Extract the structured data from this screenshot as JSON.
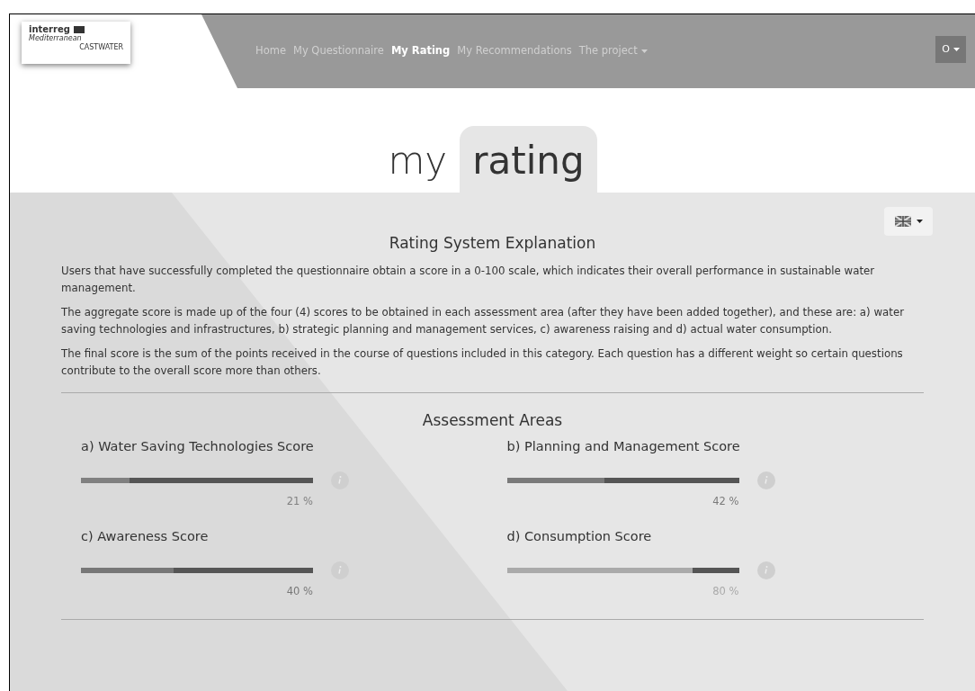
{
  "logo": {
    "line_1": "interreg",
    "line_2": "Mediterranean",
    "line_3": "CASTWATER"
  },
  "nav": {
    "items": [
      {
        "label": "Home",
        "selected": false,
        "dropdown": false
      },
      {
        "label": "My Questionnaire",
        "selected": false,
        "dropdown": false
      },
      {
        "label": "My Rating",
        "selected": true,
        "dropdown": false
      },
      {
        "label": "My Recommendations",
        "selected": false,
        "dropdown": false
      },
      {
        "label": "The project",
        "selected": false,
        "dropdown": true
      }
    ],
    "user_button": "O"
  },
  "title": {
    "word_1": "my",
    "word_2": "rating"
  },
  "explanation": {
    "heading": "Rating System Explanation",
    "paragraphs": [
      "Users that have successfully completed the questionnaire obtain a score in a 0-100 scale, which indicates their overall performance in sustainable water management.",
      "The aggregate score is made up of the four (4) scores to be obtained in each assessment area (after they have been added together), and these are: a) water saving technologies and infrastructures, b) strategic planning and management services, c) awareness raising and d) actual water consumption.",
      "The final score is the sum of the points received in the course of questions included in this category. Each question has a different weight so certain questions contribute to the overall score more than others."
    ]
  },
  "assessment": {
    "heading": "Assessment Areas",
    "scores": [
      {
        "label": "a) Water Saving Technologies Score",
        "level": 0.21,
        "reading": "21 %",
        "color": "#808080"
      },
      {
        "label": "b) Planning and Management Score",
        "level": 0.42,
        "reading": "42 %",
        "color": "#7a7a7a"
      },
      {
        "label": "c) Awareness Score",
        "level": 0.4,
        "reading": "40 %",
        "color": "#777777"
      },
      {
        "label": "d) Consumption Score",
        "level": 0.8,
        "reading": "80 %",
        "color": "#aaaaaa"
      }
    ]
  }
}
